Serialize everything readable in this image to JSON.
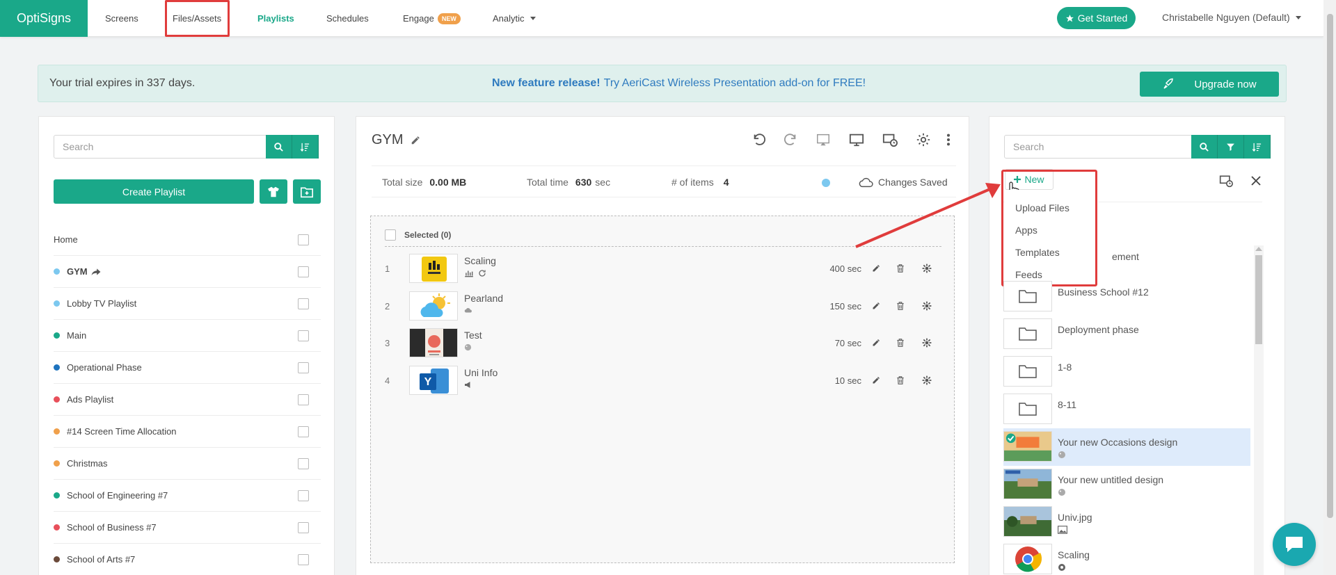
{
  "nav": {
    "logo": "OptiSigns",
    "items": [
      {
        "label": "Screens"
      },
      {
        "label": "Files/Assets"
      },
      {
        "label": "Playlists"
      },
      {
        "label": "Schedules"
      },
      {
        "label": "Engage",
        "badge": "NEW"
      },
      {
        "label": "Analytic"
      }
    ],
    "get_started": "Get Started",
    "user": "Christabelle Nguyen (Default)"
  },
  "banner": {
    "trial": "Your trial expires in 337 days.",
    "feature_bold": "New feature release!",
    "feature_rest": "Try AeriCast Wireless Presentation add-on for FREE!",
    "upgrade": "Upgrade now"
  },
  "left": {
    "search_placeholder": "Search",
    "create_playlist": "Create Playlist",
    "home": "Home",
    "playlists": [
      {
        "name": "GYM",
        "color": "#7cc8ef",
        "bold": true,
        "shared": true
      },
      {
        "name": "Lobby TV Playlist",
        "color": "#7cc8ef"
      },
      {
        "name": "Main",
        "color": "#1aa889"
      },
      {
        "name": "Operational Phase",
        "color": "#1e73be"
      },
      {
        "name": "Ads Playlist",
        "color": "#e8505b"
      },
      {
        "name": "#14 Screen Time Allocation",
        "color": "#f0a04b"
      },
      {
        "name": "Christmas",
        "color": "#f0a04b"
      },
      {
        "name": "School of Engineering #7",
        "color": "#1aa889"
      },
      {
        "name": "School of Business #7",
        "color": "#e8505b"
      },
      {
        "name": "School of Arts #7",
        "color": "#6b4a3a"
      }
    ]
  },
  "playlist": {
    "title": "GYM",
    "total_size_label": "Total size",
    "total_size": "0.00 MB",
    "total_time_label": "Total time",
    "total_time": "630",
    "total_time_unit": "sec",
    "items_label": "# of items",
    "items_count": "4",
    "saved": "Changes Saved",
    "selected": "Selected (0)",
    "items": [
      {
        "num": "1",
        "name": "Scaling",
        "duration": "400 sec"
      },
      {
        "num": "2",
        "name": "Pearland",
        "duration": "150 sec"
      },
      {
        "num": "3",
        "name": "Test",
        "duration": "70 sec"
      },
      {
        "num": "4",
        "name": "Uni Info",
        "duration": "10 sec"
      }
    ]
  },
  "right": {
    "search_placeholder": "Search",
    "new_label": "New",
    "dropdown": [
      "Upload Files",
      "Apps",
      "Templates",
      "Feeds"
    ],
    "partial_item": "ement",
    "assets": [
      {
        "name": "Business School #12",
        "type": "folder"
      },
      {
        "name": "Deployment phase",
        "type": "folder"
      },
      {
        "name": "1-8",
        "type": "folder"
      },
      {
        "name": "8-11",
        "type": "folder"
      },
      {
        "name": "Your new Occasions design",
        "type": "design",
        "selected": true
      },
      {
        "name": "Your new untitled design",
        "type": "design"
      },
      {
        "name": "Univ.jpg",
        "type": "image"
      },
      {
        "name": "Scaling",
        "type": "web"
      }
    ]
  },
  "colors": {
    "accent": "#1aa889",
    "annotation": "#e03c3c",
    "link": "#2f7bbf"
  }
}
